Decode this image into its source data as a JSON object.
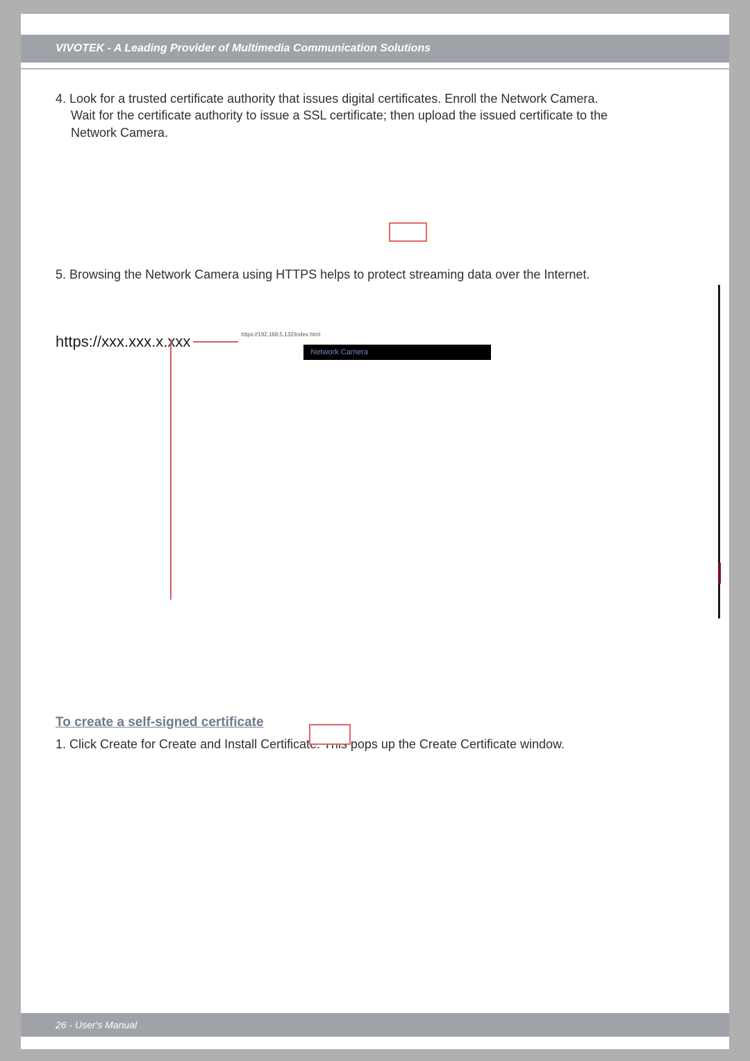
{
  "header": {
    "title": "VIVOTEK - A Leading Provider of Multimedia Communication Solutions"
  },
  "step4": {
    "num": "4.",
    "line1": "Look for a trusted certificate authority that issues digital certificates. Enroll the Network Camera.",
    "line2": "Wait for the certificate authority to issue a SSL certificate; then upload the issued certificate to the",
    "line3": "Network Camera."
  },
  "step5": {
    "num": "5.",
    "text": "Browsing the Network Camera using HTTPS helps to protect streaming data over the Internet."
  },
  "url": {
    "label": "https://xxx.xxx.x.xxx",
    "micro": "https://192.168.5.132/index.html",
    "tab_title": "Network Camera"
  },
  "section": {
    "heading": "To create a self-signed certificate",
    "step1": "1. Click Create for Create and Install Certificate. This pops up the Create Certificate window."
  },
  "footer": {
    "text": "26 - User's Manual"
  }
}
